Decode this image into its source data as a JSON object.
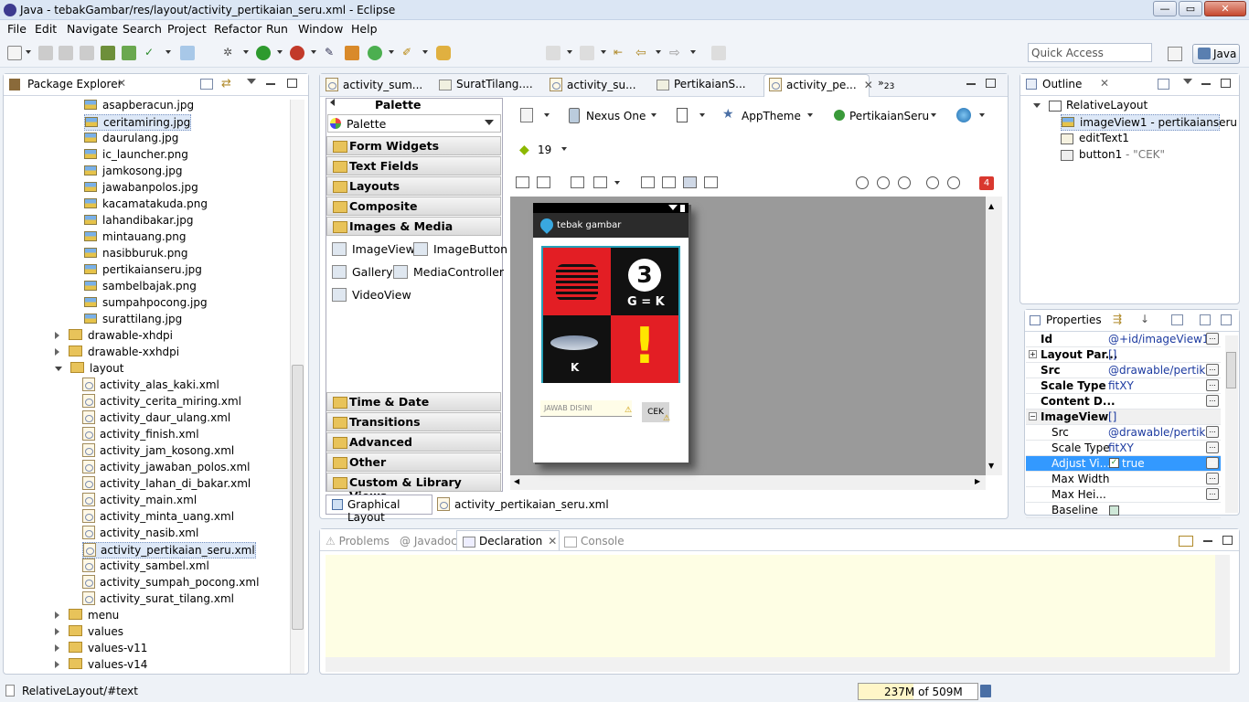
{
  "window": {
    "title": "Java - tebakGambar/res/layout/activity_pertikaian_seru.xml - Eclipse"
  },
  "menu": [
    "File",
    "Edit",
    "Navigate",
    "Search",
    "Project",
    "Refactor",
    "Run",
    "Window",
    "Help"
  ],
  "toolbar": {
    "quick_access": "Quick Access",
    "perspective": "Java"
  },
  "package_explorer": {
    "tab": "Package Explorer",
    "images": [
      "asapberacun.jpg",
      "ceritamiring.jpg",
      "daurulang.jpg",
      "ic_launcher.png",
      "jamkosong.jpg",
      "jawabanpolos.jpg",
      "kacamatakuda.png",
      "lahandibakar.jpg",
      "mintauang.png",
      "nasibburuk.png",
      "pertikaianseru.jpg",
      "sambelbajak.png",
      "sumpahpocong.jpg",
      "surattilang.jpg"
    ],
    "folders_a": [
      "drawable-xhdpi",
      "drawable-xxhdpi",
      "layout"
    ],
    "layouts": [
      "activity_alas_kaki.xml",
      "activity_cerita_miring.xml",
      "activity_daur_ulang.xml",
      "activity_finish.xml",
      "activity_jam_kosong.xml",
      "activity_jawaban_polos.xml",
      "activity_lahan_di_bakar.xml",
      "activity_main.xml",
      "activity_minta_uang.xml",
      "activity_nasib.xml",
      "activity_pertikaian_seru.xml",
      "activity_sambel.xml",
      "activity_sumpah_pocong.xml",
      "activity_surat_tilang.xml"
    ],
    "folders_b": [
      "menu",
      "values",
      "values-v11",
      "values-v14"
    ]
  },
  "editor": {
    "tabs": [
      "activity_sum...",
      "SuratTilang....",
      "activity_su...",
      "PertikaianS...",
      "activity_pe..."
    ],
    "overflow": "23",
    "palette_title": "Palette",
    "palette_combo": "Palette",
    "categories_top": [
      "Form Widgets",
      "Text Fields",
      "Layouts",
      "Composite",
      "Images & Media"
    ],
    "image_widgets": [
      "ImageView",
      "ImageButton",
      "Gallery",
      "MediaController",
      "VideoView"
    ],
    "categories_bottom": [
      "Time & Date",
      "Transitions",
      "Advanced",
      "Other",
      "Custom & Library Views"
    ],
    "device": "Nexus One",
    "theme": "AppTheme",
    "activity": "PertikaianSeru",
    "api": "19",
    "error_count": "4",
    "phone": {
      "app_title": "tebak gambar",
      "hint": "JAWAB DISINI",
      "button": "CEK",
      "tile1": "3",
      "tile2": "G = K",
      "tile3": "K",
      "tile4": "!"
    },
    "bottom_tabs": [
      "Graphical Layout",
      "activity_pertikaian_seru.xml"
    ]
  },
  "outline": {
    "tab": "Outline",
    "root": "RelativeLayout",
    "children": [
      {
        "name": "imageView1",
        "extra": " - pertikaianseru"
      },
      {
        "name": "editText1",
        "extra": ""
      },
      {
        "name": "button1",
        "extra": " - \"CEK\""
      }
    ]
  },
  "properties": {
    "tab": "Properties",
    "rows": [
      {
        "k": "Id",
        "v": "@+id/imageView1"
      },
      {
        "k": "Layout Par...",
        "v": "[]"
      },
      {
        "k": "Src",
        "v": "@drawable/pertik..."
      },
      {
        "k": "Scale Type",
        "v": "fitXY"
      },
      {
        "k": "Content D...",
        "v": ""
      },
      {
        "k": "ImageView",
        "v": "[]"
      },
      {
        "k": "Src",
        "v": "@drawable/pertik..."
      },
      {
        "k": "Scale Type",
        "v": "fitXY"
      },
      {
        "k": "Adjust Vi...",
        "v": "true"
      },
      {
        "k": "Max Width",
        "v": ""
      },
      {
        "k": "Max Hei...",
        "v": ""
      },
      {
        "k": "Baseline",
        "v": ""
      }
    ]
  },
  "bottom": {
    "tabs": [
      "Problems",
      "Javadoc",
      "Declaration",
      "Console"
    ]
  },
  "status": {
    "path": "RelativeLayout/#text",
    "memory": "237M of 509M"
  }
}
